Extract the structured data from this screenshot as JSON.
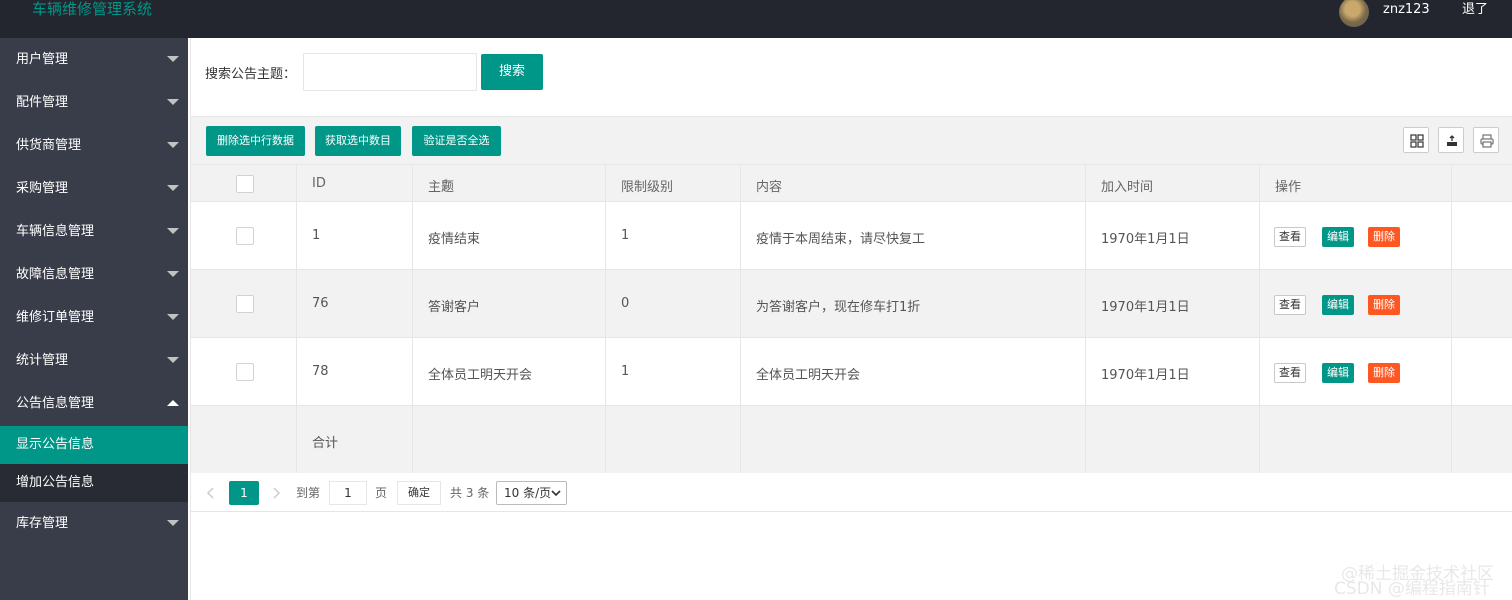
{
  "header": {
    "app_title": "车辆维修管理系统",
    "username": "znz123",
    "logout_label": "退了"
  },
  "sidebar": {
    "items": [
      {
        "label": "用户管理"
      },
      {
        "label": "配件管理"
      },
      {
        "label": "供货商管理"
      },
      {
        "label": "采购管理"
      },
      {
        "label": "车辆信息管理"
      },
      {
        "label": "故障信息管理"
      },
      {
        "label": "维修订单管理"
      },
      {
        "label": "统计管理"
      },
      {
        "label": "公告信息管理"
      },
      {
        "label": "库存管理"
      }
    ],
    "subitems": [
      {
        "label": "显示公告信息"
      },
      {
        "label": "增加公告信息"
      }
    ]
  },
  "search": {
    "label": "搜索公告主题：",
    "value": "",
    "button": "搜索"
  },
  "toolbar": {
    "buttons": [
      "删除选中行数据",
      "获取选中数目",
      "验证是否全选"
    ],
    "icons": [
      "grid-columns-icon",
      "export-icon",
      "print-icon"
    ]
  },
  "table": {
    "columns": [
      "ID",
      "主题",
      "限制级别",
      "内容",
      "加入时间",
      "操作"
    ],
    "rows": [
      {
        "id": "1",
        "title": "疫情结束",
        "level": "1",
        "content": "疫情于本周结束，请尽快复工",
        "time": "1970年1月1日"
      },
      {
        "id": "76",
        "title": "答谢客户",
        "level": "0",
        "content": "为答谢客户，现在修车打1折",
        "time": "1970年1月1日"
      },
      {
        "id": "78",
        "title": "全体员工明天开会",
        "level": "1",
        "content": "全体员工明天开会",
        "time": "1970年1月1日"
      }
    ],
    "actions": {
      "view": "查看",
      "edit": "编辑",
      "delete": "删除"
    },
    "total_label": "合计"
  },
  "pager": {
    "current": "1",
    "goto_label": "到第",
    "page_input": "1",
    "page_unit": "页",
    "confirm": "确定",
    "total": "共 3 条",
    "page_size": "10 条/页"
  },
  "watermark": {
    "line1": "@稀土掘金技术社区",
    "line2": "CSDN @编程指南针"
  }
}
